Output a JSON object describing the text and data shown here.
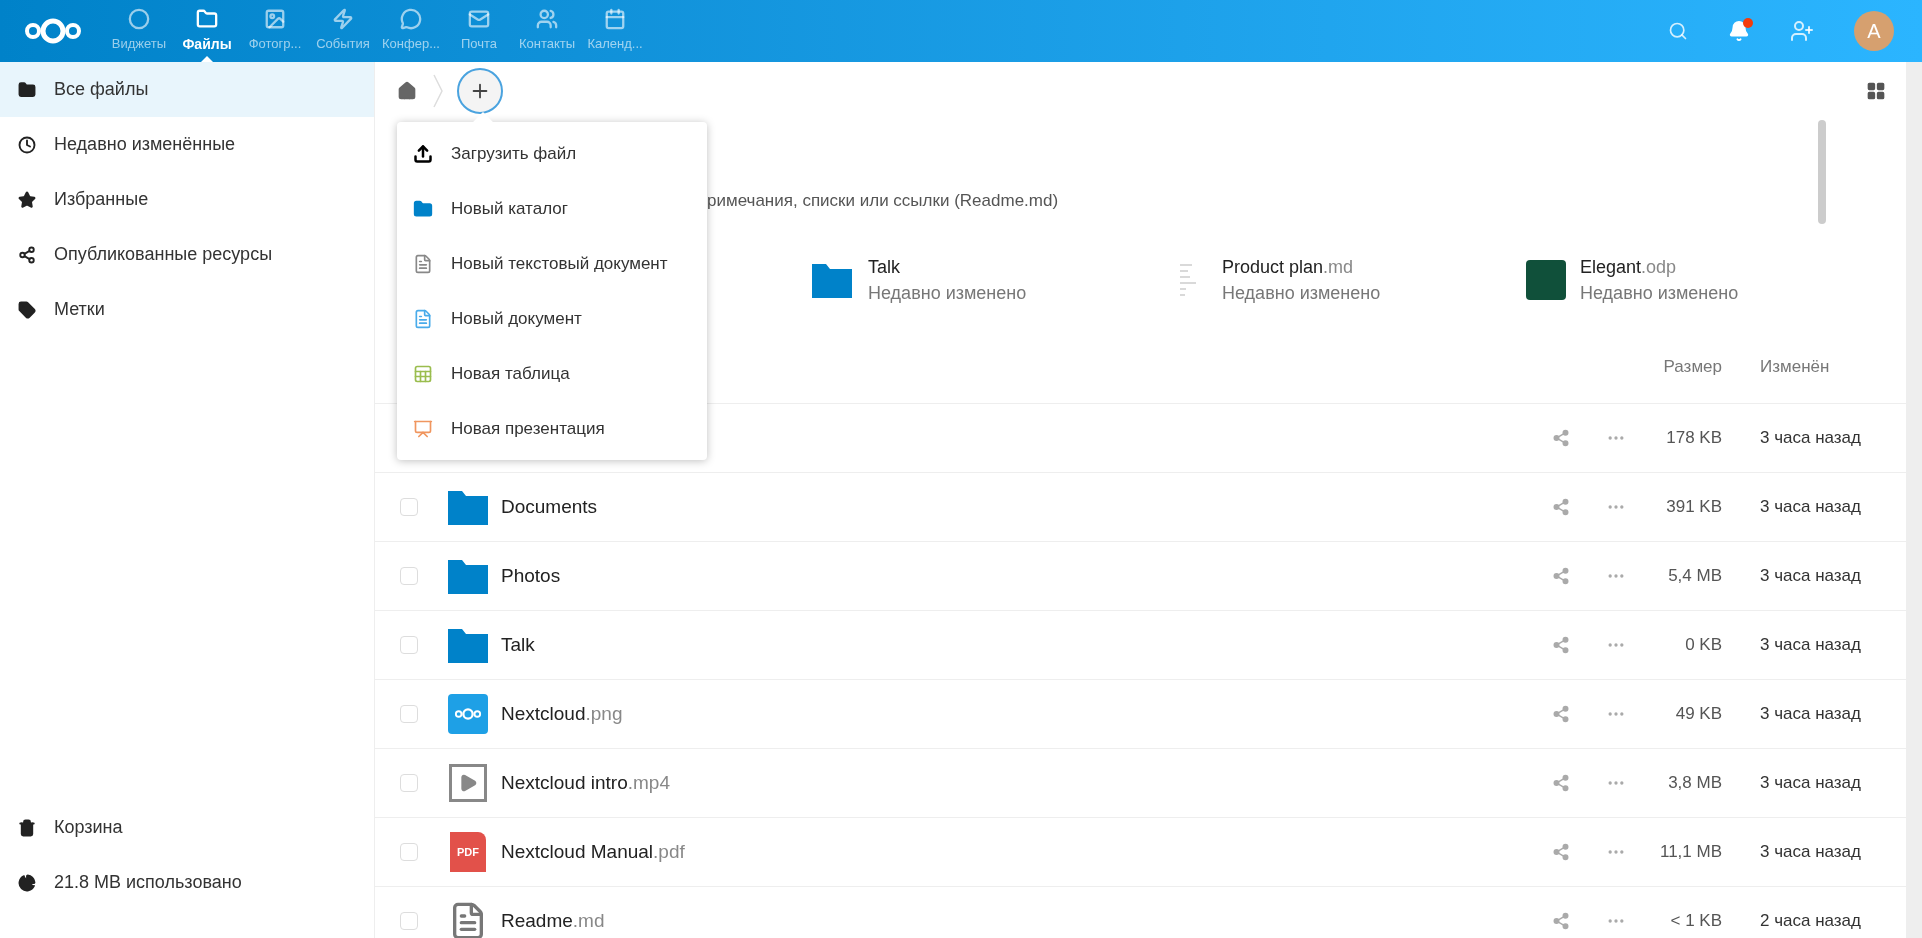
{
  "header": {
    "apps": [
      {
        "label": "Виджеты",
        "kind": "dashboard",
        "selected": false
      },
      {
        "label": "Файлы",
        "kind": "files",
        "selected": true
      },
      {
        "label": "Фотогр...",
        "kind": "photos",
        "selected": false
      },
      {
        "label": "События",
        "kind": "activity",
        "selected": false
      },
      {
        "label": "Конфер...",
        "kind": "talk",
        "selected": false
      },
      {
        "label": "Почта",
        "kind": "mail",
        "selected": false
      },
      {
        "label": "Контакты",
        "kind": "contacts",
        "selected": false
      },
      {
        "label": "Календ...",
        "kind": "calendar",
        "selected": false
      }
    ],
    "notifications": {
      "unread": true
    },
    "avatar": {
      "initial": "A"
    }
  },
  "sidebar": {
    "items": [
      {
        "label": "Все файлы",
        "kind": "folder",
        "selected": true
      },
      {
        "label": "Недавно изменённые",
        "kind": "clock",
        "selected": false
      },
      {
        "label": "Избранные",
        "kind": "star",
        "selected": false
      },
      {
        "label": "Опубликованные ресурсы",
        "kind": "share",
        "selected": false
      },
      {
        "label": "Метки",
        "kind": "tag",
        "selected": false
      }
    ],
    "footer": [
      {
        "label": "Корзина",
        "kind": "trash"
      },
      {
        "label": "21.8 MB использовано",
        "kind": "quota"
      }
    ]
  },
  "new_menu": {
    "items": [
      {
        "label": "Загрузить файл",
        "kind": "upload"
      },
      {
        "label": "Новый каталог",
        "kind": "folder"
      },
      {
        "label": "Новый текстовый документ",
        "kind": "text"
      },
      {
        "label": "Новый документ",
        "kind": "document"
      },
      {
        "label": "Новая таблица",
        "kind": "spreadsheet"
      },
      {
        "label": "Новая презентация",
        "kind": "presentation"
      }
    ]
  },
  "readme": {
    "text": "римечания, списки или ссылки (Readme.md)"
  },
  "recent": [
    {
      "name": "Talk",
      "kind": "folder",
      "subtitle": "Недавно изменено"
    },
    {
      "name": "Product plan",
      "ext": ".md",
      "kind": "text-preview",
      "subtitle": "Недавно изменено"
    },
    {
      "name": "Elegant",
      "ext": ".odp",
      "kind": "slides",
      "subtitle": "Недавно изменено"
    }
  ],
  "table": {
    "columns": [
      "Размер",
      "Изменён"
    ],
    "rows": [
      {
        "size": "178 KB",
        "modified": "3 часа назад"
      },
      {
        "name": "Documents",
        "kind": "folder",
        "checked": false,
        "size": "391 KB",
        "modified": "3 часа назад"
      },
      {
        "name": "Photos",
        "kind": "folder",
        "checked": false,
        "size": "5,4 MB",
        "modified": "3 часа назад"
      },
      {
        "name": "Talk",
        "kind": "folder",
        "checked": false,
        "size": "0 KB",
        "modified": "3 часа назад"
      },
      {
        "name": "Nextcloud",
        "ext": ".png",
        "kind": "image",
        "checked": false,
        "size": "49 KB",
        "modified": "3 часа назад"
      },
      {
        "name": "Nextcloud intro",
        "ext": ".mp4",
        "kind": "video",
        "checked": false,
        "size": "3,8 MB",
        "modified": "3 часа назад"
      },
      {
        "name": "Nextcloud Manual",
        "ext": ".pdf",
        "kind": "pdf",
        "badge": "PDF",
        "checked": false,
        "size": "11,1 MB",
        "modified": "3 часа назад"
      },
      {
        "name": "Readme",
        "ext": ".md",
        "kind": "text",
        "checked": false,
        "size": "< 1 KB",
        "modified": "2 часа назад"
      }
    ]
  }
}
